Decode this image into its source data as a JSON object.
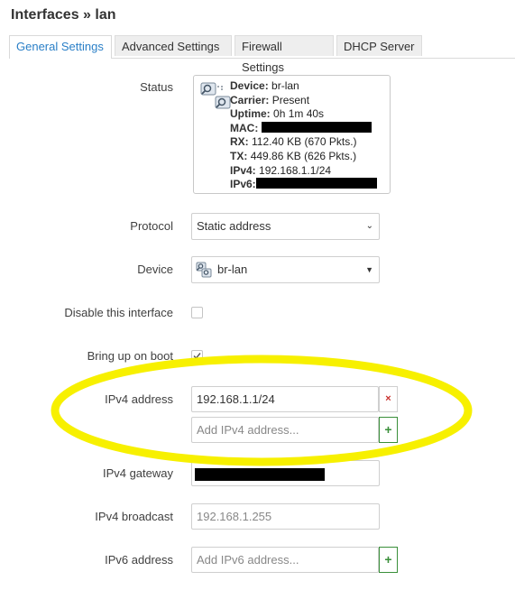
{
  "page": {
    "title": "Interfaces » lan"
  },
  "tabs": [
    {
      "label": "General Settings",
      "active": true
    },
    {
      "label": "Advanced Settings",
      "active": false
    },
    {
      "label": "Firewall Settings",
      "active": false
    },
    {
      "label": "DHCP Server",
      "active": false
    }
  ],
  "status": {
    "label": "Status",
    "device_key": "Device:",
    "device_val": "br-lan",
    "carrier_key": "Carrier:",
    "carrier_val": "Present",
    "uptime_key": "Uptime:",
    "uptime_val": "0h 1m 40s",
    "mac_key": "MAC:",
    "rx_key": "RX:",
    "rx_val": "112.40 KB (670 Pkts.)",
    "tx_key": "TX:",
    "tx_val": "449.86 KB (626 Pkts.)",
    "ipv4_key": "IPv4:",
    "ipv4_val": "192.168.1.1/24",
    "ipv6_key": "IPv6:"
  },
  "protocol": {
    "label": "Protocol",
    "value": "Static address"
  },
  "device": {
    "label": "Device",
    "value": "br-lan"
  },
  "disable": {
    "label": "Disable this interface",
    "checked": false
  },
  "boot": {
    "label": "Bring up on boot",
    "checked": true
  },
  "ipv4_address": {
    "label": "IPv4 address",
    "value": "192.168.1.1/24",
    "remove_symbol": "×",
    "add_placeholder": "Add IPv4 address...",
    "add_symbol": "+"
  },
  "ipv4_gateway": {
    "label": "IPv4 gateway"
  },
  "ipv4_broadcast": {
    "label": "IPv4 broadcast",
    "placeholder": "192.168.1.255"
  },
  "ipv6_address": {
    "label": "IPv6 address",
    "placeholder": "Add IPv6 address...",
    "add_symbol": "+"
  },
  "colors": {
    "accent": "#2a7fc7",
    "highlight": "#f7f000",
    "add": "#3a8f3a",
    "remove": "#c9302c"
  }
}
